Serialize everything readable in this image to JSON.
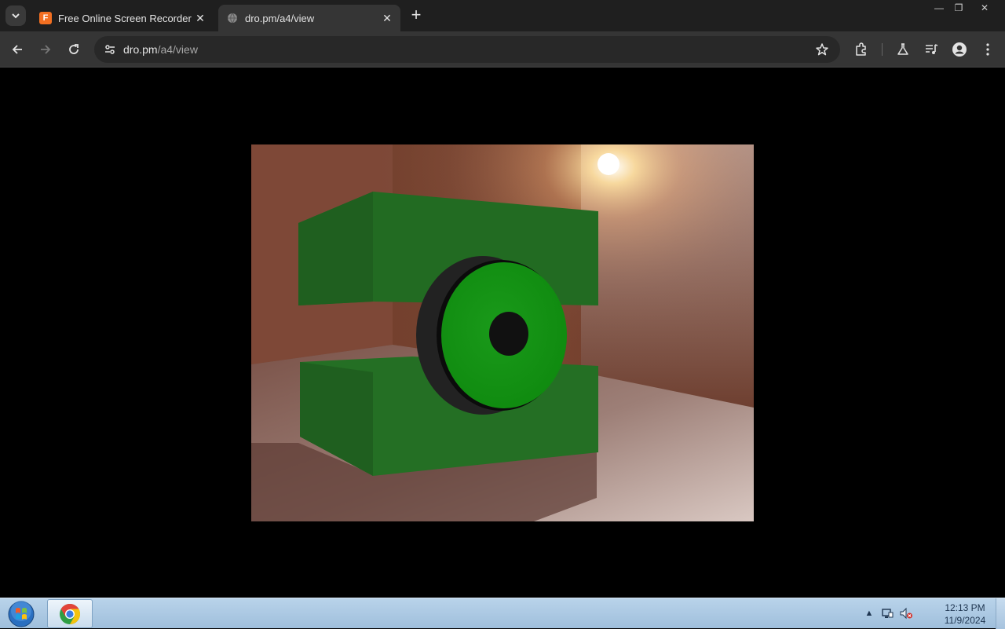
{
  "browser": {
    "tabs": [
      {
        "title": "Free Online Screen Recorder &",
        "favicon": "F",
        "favicon_color": "#f36f21",
        "active": false
      },
      {
        "title": "dro.pm/a4/view",
        "favicon": "globe-icon",
        "active": true
      }
    ],
    "url": {
      "host": "dro.pm",
      "path": "/a4/view"
    }
  },
  "page": {
    "background": "#000000",
    "content": "3d-render"
  },
  "taskbar": {
    "clock_time": "12:13 PM",
    "clock_date": "11/9/2024",
    "tray_icons": [
      "show-hidden-icons",
      "network-icon",
      "volume-muted-icon"
    ]
  }
}
